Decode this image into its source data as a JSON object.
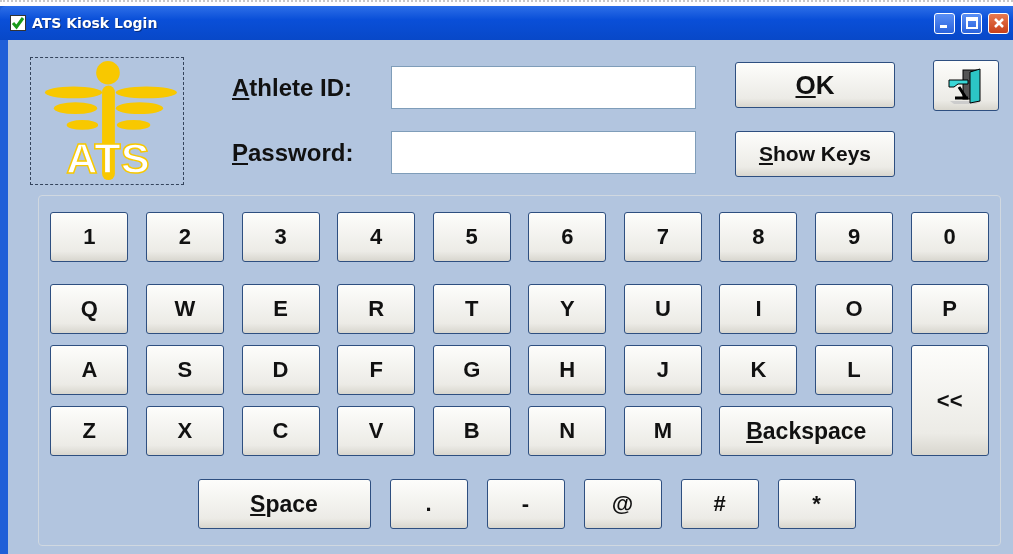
{
  "window": {
    "title": "ATS Kiosk Login"
  },
  "logo": {
    "text": "ATS"
  },
  "fields": [
    {
      "underline": "A",
      "text": "thlete ID:"
    },
    {
      "underline": "P",
      "text": "assword:"
    }
  ],
  "buttons": [
    {
      "kind": "ok",
      "underline": "O",
      "text": "K"
    },
    {
      "kind": "show_keys",
      "underline": "S",
      "text": "how Keys"
    },
    {
      "kind": "exit"
    }
  ],
  "keyboard": {
    "rows": [
      [
        {
          "kind": "char",
          "text": "1"
        },
        {
          "kind": "char",
          "text": "2"
        },
        {
          "kind": "char",
          "text": "3"
        },
        {
          "kind": "char",
          "text": "4"
        },
        {
          "kind": "char",
          "text": "5"
        },
        {
          "kind": "char",
          "text": "6"
        },
        {
          "kind": "char",
          "text": "7"
        },
        {
          "kind": "char",
          "text": "8"
        },
        {
          "kind": "char",
          "text": "9"
        },
        {
          "kind": "char",
          "text": "0"
        }
      ],
      [
        {
          "kind": "char",
          "text": "Q"
        },
        {
          "kind": "char",
          "text": "W"
        },
        {
          "kind": "char",
          "text": "E"
        },
        {
          "kind": "char",
          "text": "R"
        },
        {
          "kind": "char",
          "text": "T"
        },
        {
          "kind": "char",
          "text": "Y"
        },
        {
          "kind": "char",
          "text": "U"
        },
        {
          "kind": "char",
          "text": "I"
        },
        {
          "kind": "char",
          "text": "O"
        },
        {
          "kind": "char",
          "text": "P"
        }
      ],
      [
        {
          "kind": "char",
          "text": "A"
        },
        {
          "kind": "char",
          "text": "S"
        },
        {
          "kind": "char",
          "text": "D"
        },
        {
          "kind": "char",
          "text": "F"
        },
        {
          "kind": "char",
          "text": "G"
        },
        {
          "kind": "char",
          "text": "H"
        },
        {
          "kind": "char",
          "text": "J"
        },
        {
          "kind": "char",
          "text": "K"
        },
        {
          "kind": "char",
          "text": "L"
        },
        {
          "kind": "tall",
          "text": "<<"
        }
      ],
      [
        {
          "kind": "char",
          "text": "Z"
        },
        {
          "kind": "char",
          "text": "X"
        },
        {
          "kind": "char",
          "text": "C"
        },
        {
          "kind": "char",
          "text": "V"
        },
        {
          "kind": "char",
          "text": "B"
        },
        {
          "kind": "char",
          "text": "N"
        },
        {
          "kind": "char",
          "text": "M"
        },
        {
          "kind": "wide",
          "underline": "B",
          "text": "ackspace"
        }
      ]
    ],
    "bottom": [
      {
        "kind": "space",
        "underline": "S",
        "text": "pace"
      },
      {
        "kind": "char",
        "text": "."
      },
      {
        "kind": "char",
        "text": "-"
      },
      {
        "kind": "char",
        "text": "@"
      },
      {
        "kind": "char",
        "text": "#"
      },
      {
        "kind": "char",
        "text": "*"
      }
    ]
  }
}
